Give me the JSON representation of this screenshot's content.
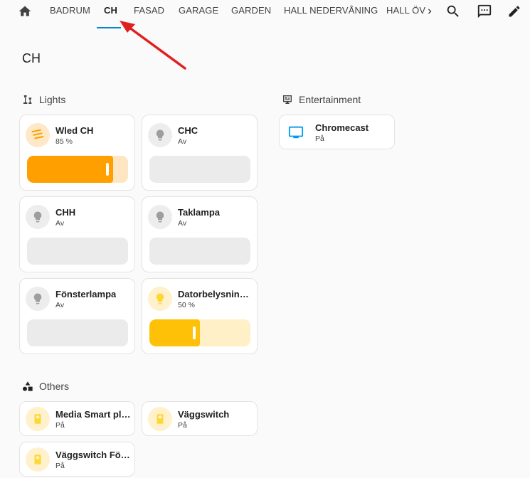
{
  "nav": {
    "tabs": [
      {
        "label": "BADRUM"
      },
      {
        "label": "CH"
      },
      {
        "label": "FASAD"
      },
      {
        "label": "GARAGE"
      },
      {
        "label": "GARDEN"
      },
      {
        "label": "HALL NEDERVÅNING"
      },
      {
        "label": "HALL ÖV"
      }
    ],
    "active_tab": "CH",
    "icons": [
      "home-icon",
      "chevron-right-icon",
      "search-icon",
      "assist-chat-icon",
      "pencil-edit-icon"
    ]
  },
  "page": {
    "title": "CH"
  },
  "sections": {
    "lights": {
      "title": "Lights",
      "icon": "lamps-icon",
      "cards": [
        {
          "name": "Wled CH",
          "state": "85 %",
          "icon": "led-strip-icon",
          "brightness": 0.85,
          "color": "#ffa000",
          "track": "#ffe6c2"
        },
        {
          "name": "CHC",
          "state": "Av",
          "icon": "lightbulb-icon",
          "brightness": 0
        },
        {
          "name": "CHH",
          "state": "Av",
          "icon": "lightbulb-icon",
          "brightness": 0
        },
        {
          "name": "Taklampa",
          "state": "Av",
          "icon": "lightbulb-icon",
          "brightness": 0
        },
        {
          "name": "Fönsterlampa",
          "state": "Av",
          "icon": "lightbulb-icon",
          "brightness": 0
        },
        {
          "name": "Datorbelysning ...",
          "state": "50 %",
          "icon": "lightbulb-icon",
          "brightness": 0.5,
          "color": "#ffc107",
          "track": "#fff0c7"
        }
      ]
    },
    "entertainment": {
      "title": "Entertainment",
      "icon": "television-guide-icon",
      "cards": [
        {
          "name": "Chromecast",
          "state": "På",
          "icon": "television-icon",
          "color": "#039be5"
        }
      ]
    },
    "others": {
      "title": "Others",
      "icon": "shapes-icon",
      "cards": [
        {
          "name": "Media Smart plug",
          "state": "På",
          "icon": "power-socket-icon"
        },
        {
          "name": "Väggswitch",
          "state": "På",
          "icon": "light-switch-icon"
        },
        {
          "name": "Väggswitch Fön...",
          "state": "På",
          "icon": "light-switch-icon"
        }
      ]
    }
  },
  "colors": {
    "accent": "#0288d1",
    "annotation": "#e02020",
    "on_icon": "#fdd835",
    "off_icon": "#9e9e9e"
  }
}
